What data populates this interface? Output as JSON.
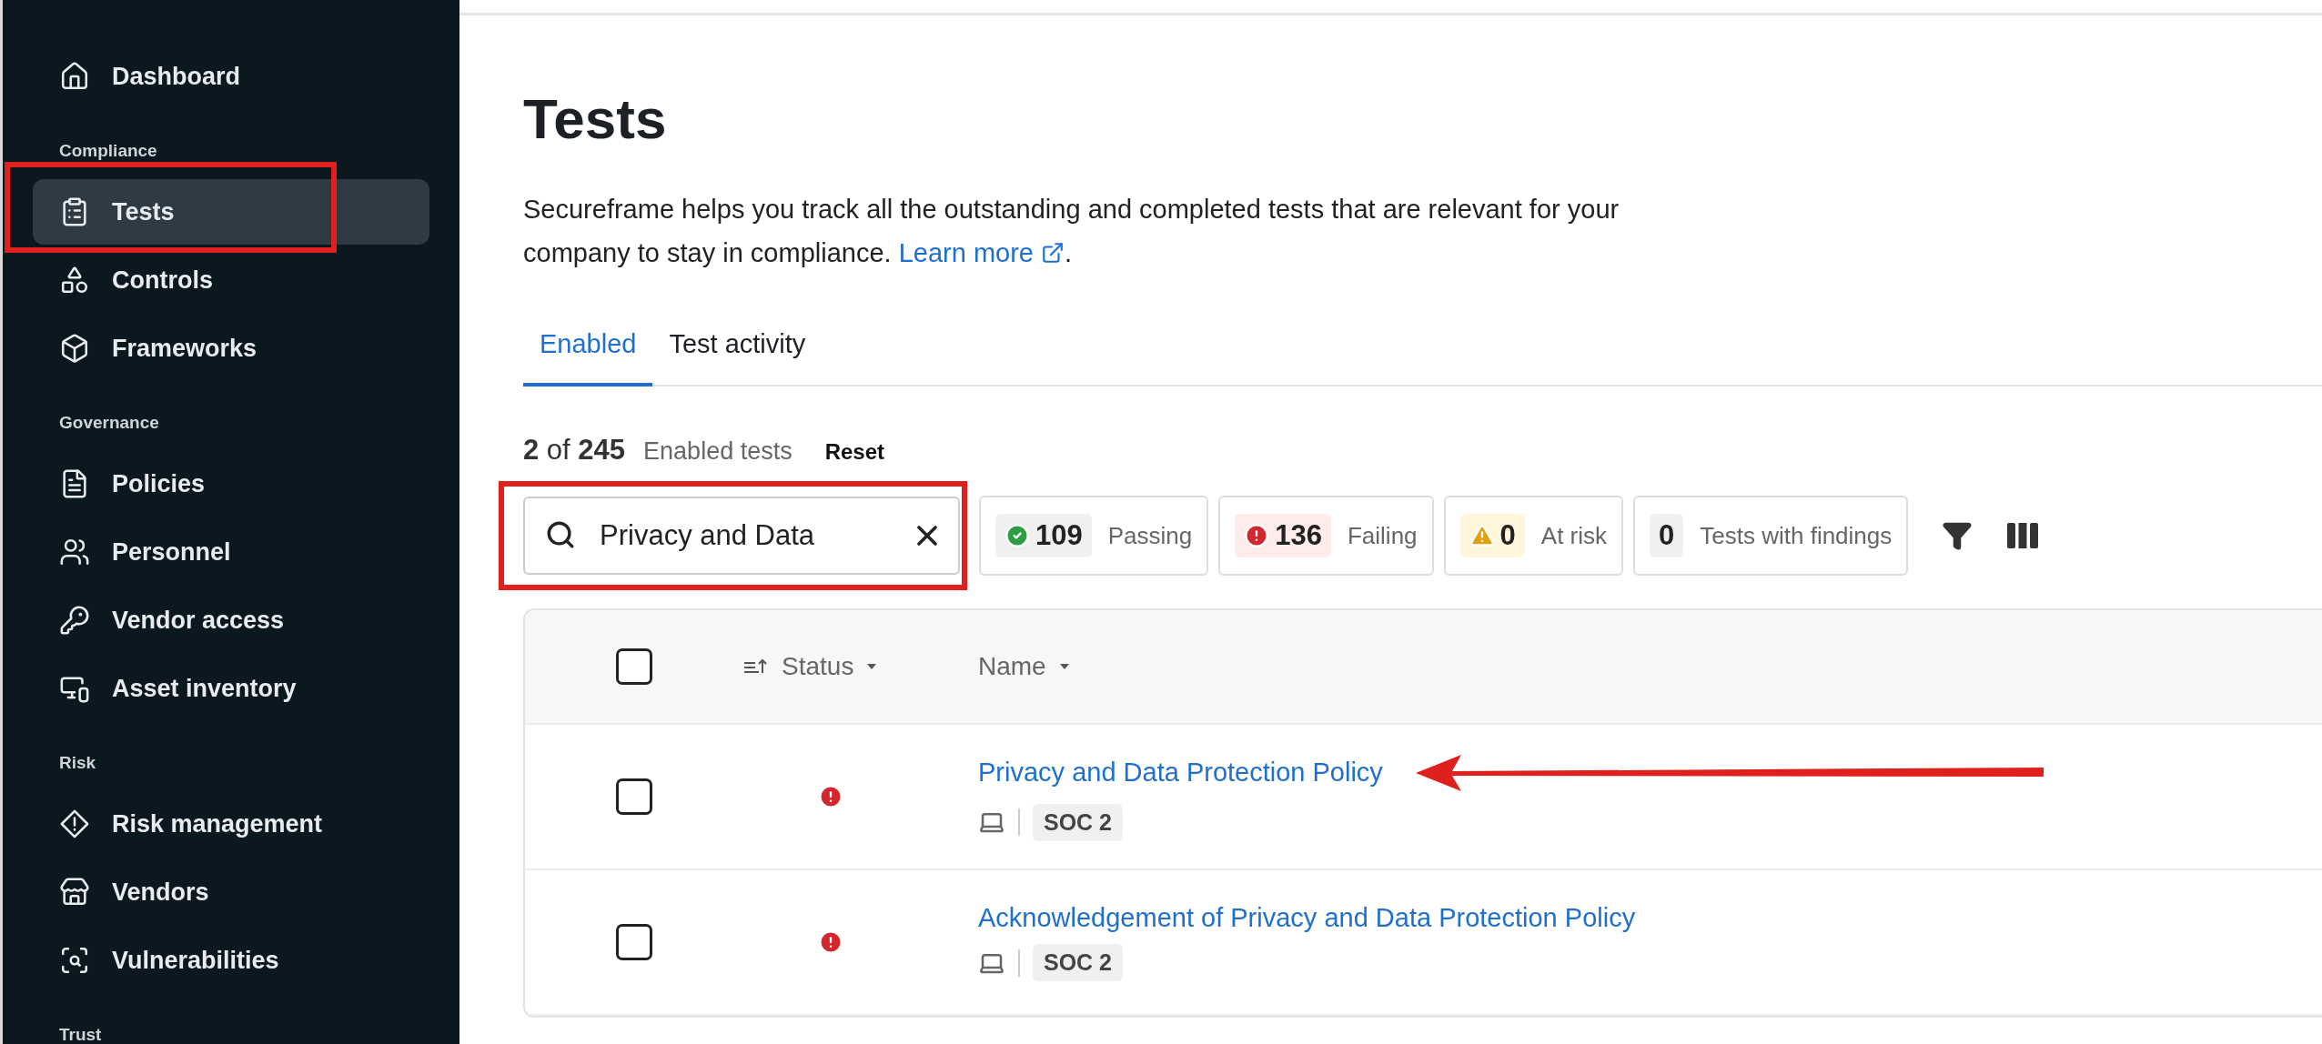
{
  "sidebar": {
    "sections": [
      {
        "items": [
          {
            "label": "Dashboard",
            "selected": false,
            "highlighted": false
          }
        ]
      },
      {
        "heading": "Compliance",
        "items": [
          {
            "label": "Tests",
            "selected": true,
            "highlighted": true
          },
          {
            "label": "Controls",
            "selected": false,
            "highlighted": false
          },
          {
            "label": "Frameworks",
            "selected": false,
            "highlighted": false
          }
        ]
      },
      {
        "heading": "Governance",
        "items": [
          {
            "label": "Policies",
            "selected": false,
            "highlighted": false
          },
          {
            "label": "Personnel",
            "selected": false,
            "highlighted": false
          },
          {
            "label": "Vendor access",
            "selected": false,
            "highlighted": false
          },
          {
            "label": "Asset inventory",
            "selected": false,
            "highlighted": false
          }
        ]
      },
      {
        "heading": "Risk",
        "items": [
          {
            "label": "Risk management",
            "selected": false,
            "highlighted": false
          },
          {
            "label": "Vendors",
            "selected": false,
            "highlighted": false
          },
          {
            "label": "Vulnerabilities",
            "selected": false,
            "highlighted": false
          }
        ]
      },
      {
        "heading": "Trust"
      }
    ]
  },
  "page": {
    "title": "Tests",
    "description": "Secureframe helps you track all the outstanding and completed tests that are relevant for your company to stay in compliance.",
    "link": "Learn more",
    "after_link": "."
  },
  "tabs": [
    {
      "label": "Enabled",
      "selected": true
    },
    {
      "label": "Test activity",
      "selected": false
    }
  ],
  "count": {
    "text": "**2** of **245**",
    "label": "Enabled tests",
    "reset": "Reset"
  },
  "search": {
    "value": "Privacy and Data",
    "highlighted": true
  },
  "chips": [
    {
      "kind": "passing",
      "count": "109",
      "label": "Passing"
    },
    {
      "kind": "failing",
      "count": "136",
      "label": "Failing"
    },
    {
      "kind": "risk",
      "count": "0",
      "label": "At risk"
    },
    {
      "kind": "findings",
      "count": "0",
      "label": "Tests with findings"
    }
  ],
  "table": {
    "select_all": false,
    "columns": [
      {
        "label": "Status"
      },
      {
        "label": "Name"
      }
    ],
    "rows": [
      {
        "checked": false,
        "kind": "failing",
        "name": "Privacy and Data Protection Policy",
        "tag": "SOC 2",
        "pointed": true
      },
      {
        "checked": false,
        "kind": "failing",
        "name": "Acknowledgement of Privacy and Data Protection Policy",
        "tag": "SOC 2",
        "pointed": false
      }
    ]
  }
}
